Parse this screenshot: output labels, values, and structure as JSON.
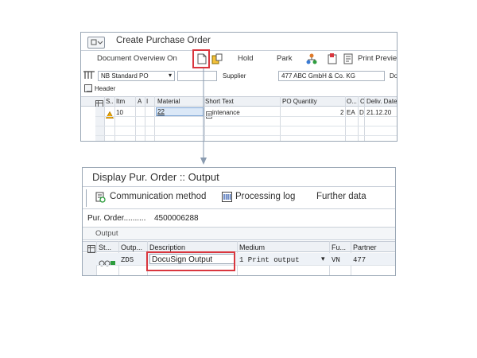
{
  "create_po": {
    "title": "Create Purchase Order",
    "toolbar": {
      "doc_overview": "Document Overview On",
      "hold": "Hold",
      "park": "Park",
      "print_preview": "Print Previe"
    },
    "header_row": {
      "po_type": "NB Standard PO",
      "supplier_label": "Supplier",
      "supplier_value": "477 ABC GmbH & Co. KG",
      "doc_date_label": "Do"
    },
    "header_label": "Header",
    "columns": [
      "S..",
      "Itm",
      "A",
      "I",
      "Material",
      "Short Text",
      "PO Quantity",
      "O...",
      "C",
      "Deliv. Date"
    ],
    "row": {
      "item": "10",
      "material": "22",
      "short_text": "intenance",
      "quantity": "2",
      "unit": "EA",
      "category": "D",
      "deliv_date": "21.12.20"
    }
  },
  "output_dialog": {
    "title": "Display Pur. Order :: Output",
    "toolbar": {
      "communication": "Communication method",
      "processing_log": "Processing log",
      "further_data": "Further data"
    },
    "pur_order_label": "Pur. Order..........",
    "pur_order_value": "4500006288",
    "section_label": "Output",
    "columns": [
      "St...",
      "Outp...",
      "Description",
      "Medium",
      "Fu...",
      "Partner"
    ],
    "row": {
      "output_type": "ZDS",
      "description": "DocuSign Output",
      "medium": "1 Print output",
      "function": "VN",
      "partner": "477"
    }
  },
  "colors": {
    "highlight": "#d9363e",
    "arrow": "#8a9bb0",
    "warning": "#f0a800",
    "status_green": "#2e9e3e"
  }
}
